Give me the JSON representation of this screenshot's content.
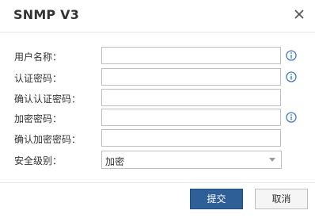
{
  "dialog": {
    "title": "SNMP V3",
    "close_icon": "close-icon"
  },
  "form": {
    "fields": [
      {
        "label": "用户名称：",
        "value": "",
        "info_icon": "info-icon"
      },
      {
        "label": "认证密码：",
        "value": "",
        "info_icon": "info-icon"
      },
      {
        "label": "确认认证密码：",
        "value": ""
      },
      {
        "label": "加密密码：",
        "value": "",
        "info_icon": "info-icon"
      },
      {
        "label": "确认加密密码：",
        "value": ""
      }
    ],
    "security_level": {
      "label": "安全级别：",
      "selected": "加密"
    }
  },
  "buttons": {
    "submit": "提交",
    "cancel": "取消"
  },
  "colors": {
    "primary_button": "#2e5f97",
    "info_icon": "#3f7cc0"
  }
}
